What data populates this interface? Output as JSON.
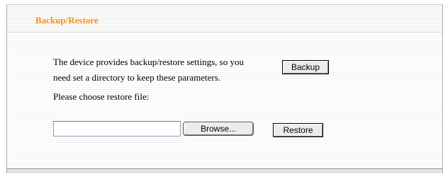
{
  "section": {
    "title": "Backup/Restore"
  },
  "backup": {
    "description_line1": "The device provides backup/restore settings, so you",
    "description_line2": "need set a directory to keep these parameters.",
    "button_label": "Backup"
  },
  "restore": {
    "prompt": "Please choose restore file:",
    "file_value": "",
    "browse_label": "Browse...",
    "button_label": "Restore"
  }
}
